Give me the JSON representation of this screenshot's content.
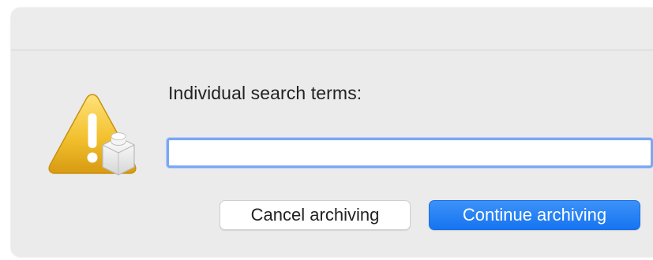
{
  "dialog": {
    "prompt_label": "Individual search terms:",
    "search_input": {
      "value": "",
      "placeholder": ""
    },
    "buttons": {
      "cancel_label": "Cancel archiving",
      "continue_label": "Continue archiving"
    },
    "icon": "warning-app-alert-icon"
  },
  "colors": {
    "accent": "#1674f0",
    "focus_ring": "#7aa7f3",
    "warning": "#f1c232"
  }
}
